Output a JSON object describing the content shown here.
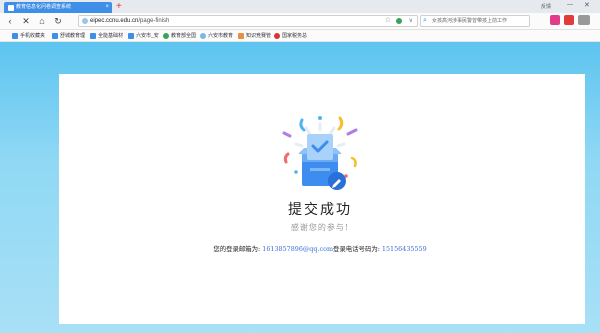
{
  "tab": {
    "title": "教育信息化问卷调查系统",
    "close": "×",
    "new_tab": "+"
  },
  "window": {
    "label": "反馈",
    "minimize": "—",
    "close": "✕"
  },
  "nav": {
    "back": "‹",
    "stop": "✕",
    "home": "⌂",
    "reload": "↻"
  },
  "address": {
    "protocol": "",
    "host": "eipec.ccnu.edu.cn",
    "path": "/page-finish",
    "star": "☆",
    "dropdown": "∨"
  },
  "search": {
    "placeholder": "女孩高河涉事民警曾带孩上前工作"
  },
  "bookmarks": [
    {
      "label": "手机收藏夹",
      "color": "#3f8fe8"
    },
    {
      "label": "舒城教育理",
      "color": "#3f8fe8"
    },
    {
      "label": "全能基础材",
      "color": "#3f8fe8"
    },
    {
      "label": "六安市_安",
      "color": "#3f8fe8"
    },
    {
      "label": "教育部全国",
      "color": "#3aa15a"
    },
    {
      "label": "六安市教育",
      "color": "#7ab6e8"
    },
    {
      "label": "知识竞赛管",
      "color": "#e8903f"
    },
    {
      "label": "国家税务总",
      "color": "#d33"
    }
  ],
  "result": {
    "title": "提交成功",
    "subtitle": "感谢您的参与!",
    "email_label": "您的登录邮箱为: ",
    "email": "1613857896@qq.com",
    "phone_label": "登录电话号码为: ",
    "phone": "15156435559"
  },
  "colors": {
    "accent": "#3f8fe8",
    "page_bg": "#7fd1f2",
    "link": "#3a6fd8"
  }
}
